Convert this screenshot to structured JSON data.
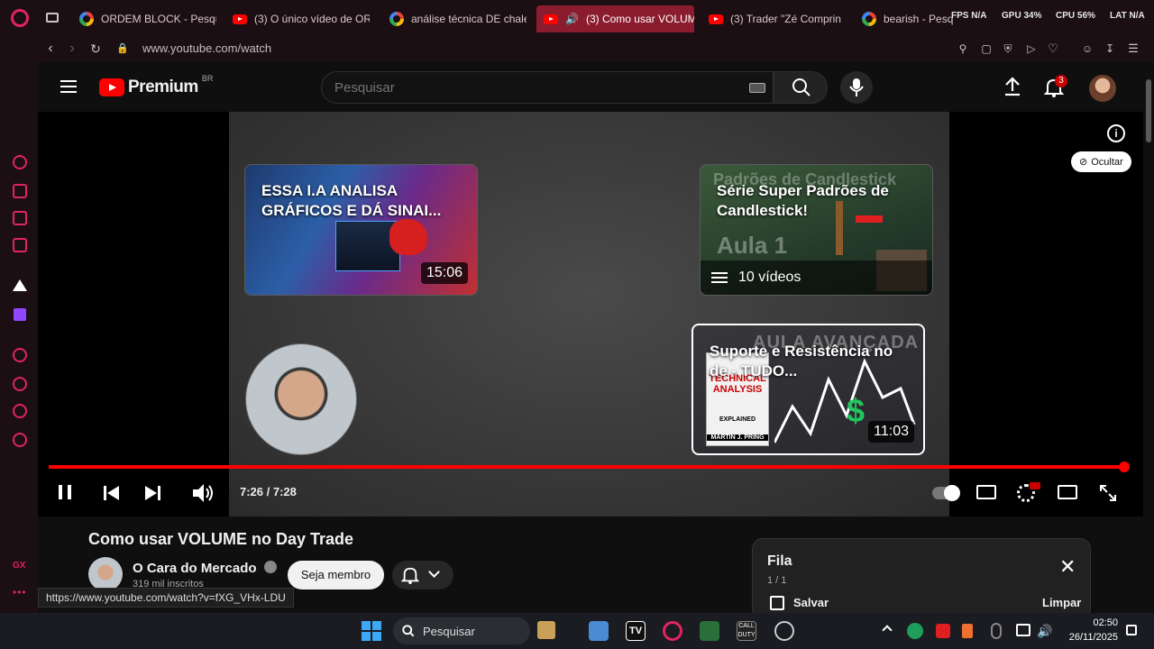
{
  "browser": {
    "tabs": [
      {
        "label": "ORDEM BLOCK - Pesqui",
        "favicon": "google"
      },
      {
        "label": "(3) O único vídeo de OR",
        "favicon": "youtube"
      },
      {
        "label": "análise técnica DE chale",
        "favicon": "google"
      },
      {
        "label": "(3) Como usar VOLUM",
        "favicon": "youtube",
        "active": true
      },
      {
        "label": "(3) Trader \"Zé Comprin",
        "favicon": "youtube"
      },
      {
        "label": "bearish - Pesquisa Goo",
        "favicon": "google"
      }
    ],
    "stats": {
      "fps": "FPS N/A",
      "gpu": "GPU 34%",
      "cpu": "CPU 56%",
      "lat": "LAT N/A"
    },
    "url": "www.youtube.com/watch",
    "status_url": "https://www.youtube.com/watch?v=fXG_VHx-LDU"
  },
  "youtube": {
    "logo_text": "Premium",
    "logo_region": "BR",
    "search_placeholder": "Pesquisar",
    "notification_count": "3"
  },
  "player": {
    "hide_label": "Ocultar",
    "end_cards": [
      {
        "title": "ESSA I.A ANALISA GRÁFICOS E DÁ SINAI...",
        "duration": "15:06"
      },
      {
        "title": "Série Super Padrões de Candlestick!",
        "badge": "10 vídeos",
        "overlay_text": "Padrões de Candlestick",
        "overlay_text2": "Aula 1"
      },
      {
        "title": "Suporte e Resistência no de - TUDO...",
        "duration": "11:03",
        "overlay_text": "AULA AVANÇADA",
        "book_title": "TECHNICAL ANALYSIS",
        "book_sub": "EXPLAINED",
        "book_author": "MARTIN J. PRING"
      }
    ],
    "time": "7:26 / 7:28",
    "progress_fraction": 0.9955
  },
  "video": {
    "title": "Como usar VOLUME no Day Trade",
    "channel": "O Cara do Mercado",
    "subscribers": "319 mil inscritos",
    "join_label": "Seja membro"
  },
  "queue": {
    "title": "Fila",
    "count": "1 / 1",
    "save_label": "Salvar",
    "clear_label": "Limpar"
  },
  "taskbar": {
    "search_label": "Pesquisar",
    "time": "02:50",
    "date": "26/11/2025"
  }
}
